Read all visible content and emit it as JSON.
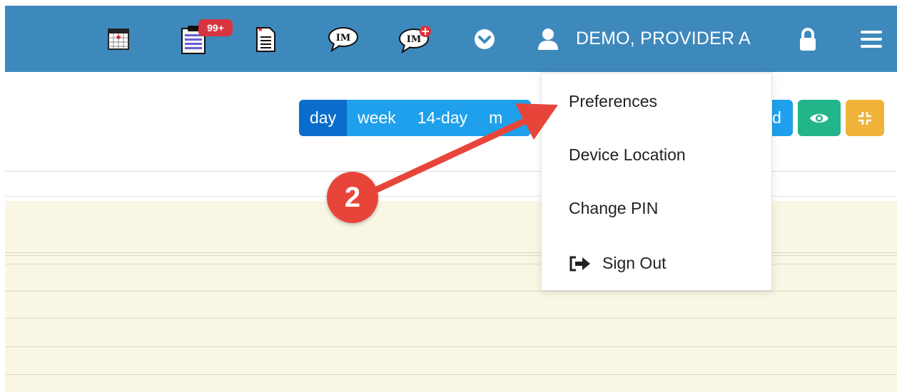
{
  "header": {
    "user_name": "DEMO, PROVIDER A",
    "tasks_badge": "99+",
    "bar_color": "#3e89bc",
    "icons": [
      "calendar-alert-icon",
      "tasks-clipboard-icon",
      "new-document-icon",
      "instant-message-icon",
      "instant-message-add-icon",
      "chevron-down-circle-icon",
      "user-icon",
      "lock-icon",
      "hamburger-menu-icon"
    ]
  },
  "view_switcher": {
    "options": [
      "day",
      "week",
      "14-day",
      "m"
    ],
    "selected": "day",
    "partial_right_label": "d"
  },
  "user_menu": {
    "items": [
      {
        "label": "Preferences"
      },
      {
        "label": "Device Location"
      },
      {
        "label": "Change PIN"
      },
      {
        "label": "Sign Out",
        "icon": "sign-out-icon"
      }
    ]
  },
  "annotation": {
    "step_number": "2",
    "color": "#e8453a"
  },
  "colors": {
    "view_active": "#0a6dcc",
    "view_inactive": "#1ea0ec",
    "eye_button": "#22b58a",
    "compress_button": "#f0b33a",
    "calendar_bg": "#f9f6e4"
  }
}
